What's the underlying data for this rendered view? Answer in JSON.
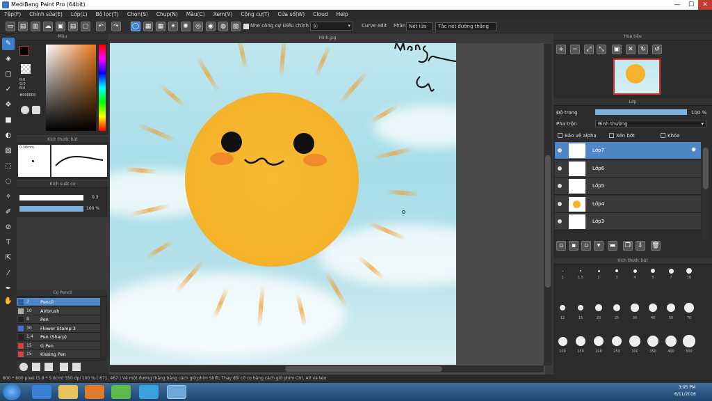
{
  "window": {
    "title": "MediBang Paint Pro (64bit)",
    "min": "—",
    "max": "☐",
    "close": "✕"
  },
  "menu": [
    "Tệp(F)",
    "Chỉnh sửa(E)",
    "Lớp(L)",
    "Bộ lọc(T)",
    "Chọn(S)",
    "Chụp(N)",
    "Màu(C)",
    "Xem(V)",
    "Cộng cự(T)",
    "Cửa sổ(W)",
    "Cloud",
    "Help"
  ],
  "toolbar": {
    "label_cong": "Nhe công cụ",
    "label_dieu": "/ Điều chỉnh",
    "dropdown_value": "Ⓧ",
    "label_curve": "Curve edit",
    "label_phan": "Phân",
    "btn_nothing": "Nét lửa",
    "btn_snap": "Tắc nét đường thẳng"
  },
  "panels": {
    "color": "Màu",
    "brush_size": "Kích thước bút",
    "opacity": "Kích suất cọ",
    "brush_list": "Cọ Pencil",
    "navigator": "Hoa tiêu",
    "layers": "Lớp",
    "brush_size_list": "Kích thước bút"
  },
  "color": {
    "r": "R:0",
    "g": "G:0",
    "b": "B:0",
    "hex": "#000000"
  },
  "brush": {
    "size": "0.30mm",
    "size_value": "0.3",
    "opacity": "100 %"
  },
  "brushes": [
    {
      "num": "3",
      "name": "Pencil",
      "color": "#2d5f9a",
      "sel": true
    },
    {
      "num": "10",
      "name": "Airbrush",
      "color": "#aaaaaa"
    },
    {
      "num": "8",
      "name": "Pen",
      "color": "#222"
    },
    {
      "num": "30",
      "name": "Flower Stamp 3",
      "color": "#4a6fd0"
    },
    {
      "num": "1.4",
      "name": "Pen (Sharp)",
      "color": "#222"
    },
    {
      "num": "15",
      "name": "G Pen",
      "color": "#d84040"
    },
    {
      "num": "15",
      "name": "Kissing Pen",
      "color": "#d84040"
    }
  ],
  "canvas": {
    "tab": "Hình.jpg",
    "signature": "Mang"
  },
  "layers": {
    "opacity_label": "Độ trong",
    "opacity_value": "100 %",
    "blend_label": "Pha trộn",
    "blend_value": "Bình thường",
    "protect": "Bảo vệ alpha",
    "clip": "Xén bớt",
    "lock": "Khóa",
    "items": [
      {
        "name": "Lớp7",
        "sel": true
      },
      {
        "name": "Lớp6"
      },
      {
        "name": "Lớp5"
      },
      {
        "name": "Lớp4",
        "sun": true
      },
      {
        "name": "Lớp3"
      }
    ]
  },
  "brush_sizes": [
    "1",
    "1.5",
    "2",
    "3",
    "4",
    "5",
    "7",
    "10",
    "12",
    "15",
    "20",
    "25",
    "30",
    "40",
    "50",
    "70",
    "100",
    "150",
    "200",
    "250",
    "300",
    "350",
    "400",
    "500"
  ],
  "status": "800 * 800 pixel   (5.8 * 5.8cm)   350 dpi   100 %   ( 671, 467 )   Vẽ một đường thẳng bằng cách giữ phím Shift; Thay đổi cỡ cọ bằng cách giữ phím Ctrl, Alt và kéo",
  "taskbar": {
    "time": "3:05 PM",
    "date": "6/11/2016"
  }
}
